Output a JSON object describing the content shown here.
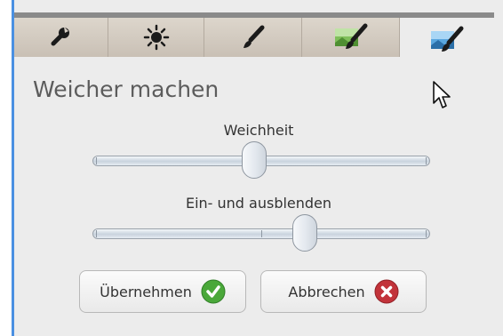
{
  "tabs": [
    {
      "icon": "wrench-icon",
      "active": false
    },
    {
      "icon": "brightness-icon",
      "active": false
    },
    {
      "icon": "brush-icon",
      "active": false
    },
    {
      "icon": "landscape-brush-icon",
      "active": false
    },
    {
      "icon": "blue-landscape-brush-icon",
      "active": true
    }
  ],
  "section": {
    "title": "Weicher machen"
  },
  "sliders": [
    {
      "label": "Weichheit",
      "value_fraction": 0.48
    },
    {
      "label": "Ein- und ausblenden",
      "value_fraction": 0.63
    }
  ],
  "buttons": {
    "apply_label": "Übernehmen",
    "cancel_label": "Abbrechen"
  },
  "colors": {
    "accent": "#4a90e2",
    "apply_icon": "#4aa83a",
    "cancel_icon": "#c2333a"
  }
}
